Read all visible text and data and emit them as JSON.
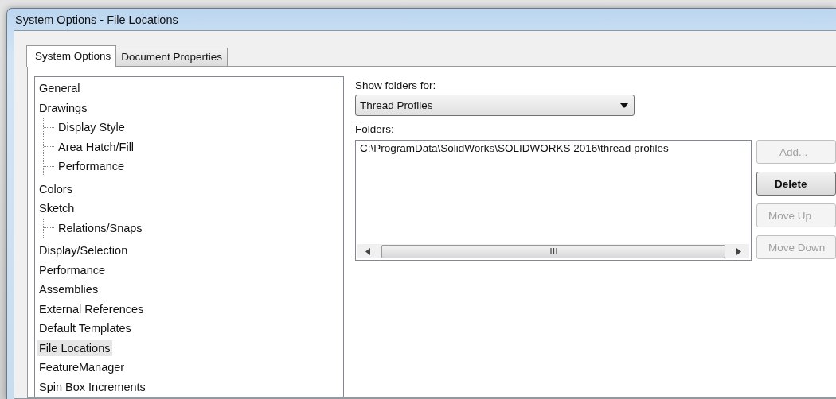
{
  "window": {
    "title": "System Options - File Locations"
  },
  "tabs": [
    {
      "label": "System Options",
      "selected": true
    },
    {
      "label": "Document Properties",
      "selected": false
    }
  ],
  "tree": {
    "items": [
      {
        "label": "General",
        "selected": false
      },
      {
        "label": "Drawings",
        "selected": false,
        "children": [
          {
            "label": "Display Style",
            "selected": false
          },
          {
            "label": "Area Hatch/Fill",
            "selected": false
          },
          {
            "label": "Performance",
            "selected": false
          }
        ]
      },
      {
        "label": "Colors",
        "selected": false
      },
      {
        "label": "Sketch",
        "selected": false,
        "children": [
          {
            "label": "Relations/Snaps",
            "selected": false
          }
        ]
      },
      {
        "label": "Display/Selection",
        "selected": false
      },
      {
        "label": "Performance",
        "selected": false
      },
      {
        "label": "Assemblies",
        "selected": false
      },
      {
        "label": "External References",
        "selected": false
      },
      {
        "label": "Default Templates",
        "selected": false
      },
      {
        "label": "File Locations",
        "selected": true
      },
      {
        "label": "FeatureManager",
        "selected": false
      },
      {
        "label": "Spin Box Increments",
        "selected": false
      }
    ]
  },
  "show_folders_for": {
    "label": "Show folders for:",
    "value": "Thread Profiles"
  },
  "folders": {
    "label": "Folders:",
    "items": [
      "C:\\ProgramData\\SolidWorks\\SOLIDWORKS 2016\\thread profiles"
    ],
    "buttons": [
      {
        "label": "Add...",
        "disabled": true
      },
      {
        "label": "Delete",
        "disabled": false
      },
      {
        "label": "Move Up",
        "disabled": true
      },
      {
        "label": "Move Down",
        "disabled": true
      }
    ]
  }
}
